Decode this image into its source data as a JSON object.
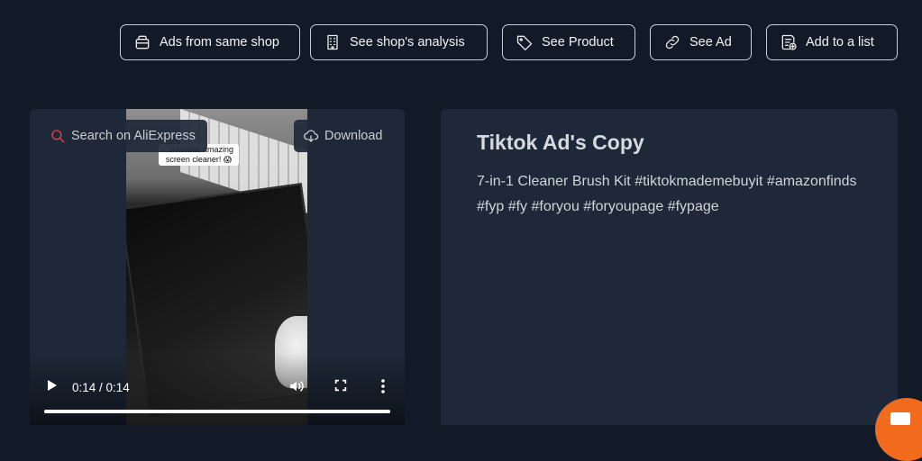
{
  "toolbar": {
    "buttons": [
      {
        "label": "Ads from same shop",
        "icon": "store-icon"
      },
      {
        "label": "See shop's analysis",
        "icon": "building-icon"
      },
      {
        "label": "See Product",
        "icon": "tag-icon"
      },
      {
        "label": "See Ad",
        "icon": "link-icon"
      },
      {
        "label": "Add to a list",
        "icon": "list-add-icon"
      }
    ]
  },
  "video": {
    "search_label": "Search on AliExpress",
    "download_label": "Download",
    "caption": "...includes amazing\nscreen cleaner! 😱",
    "time": "0:14 / 0:14",
    "progress": 1.0
  },
  "ad_copy": {
    "title": "Tiktok Ad's Copy",
    "text": "7-in-1 Cleaner Brush Kit #tiktokmademebuyit #amazonfinds #fyp #fy #foryou #foryoupage #fypage"
  },
  "colors": {
    "background": "#121a28",
    "card": "#1e2838",
    "accent_search": "#e0434f",
    "fab": "#f26a1b"
  }
}
